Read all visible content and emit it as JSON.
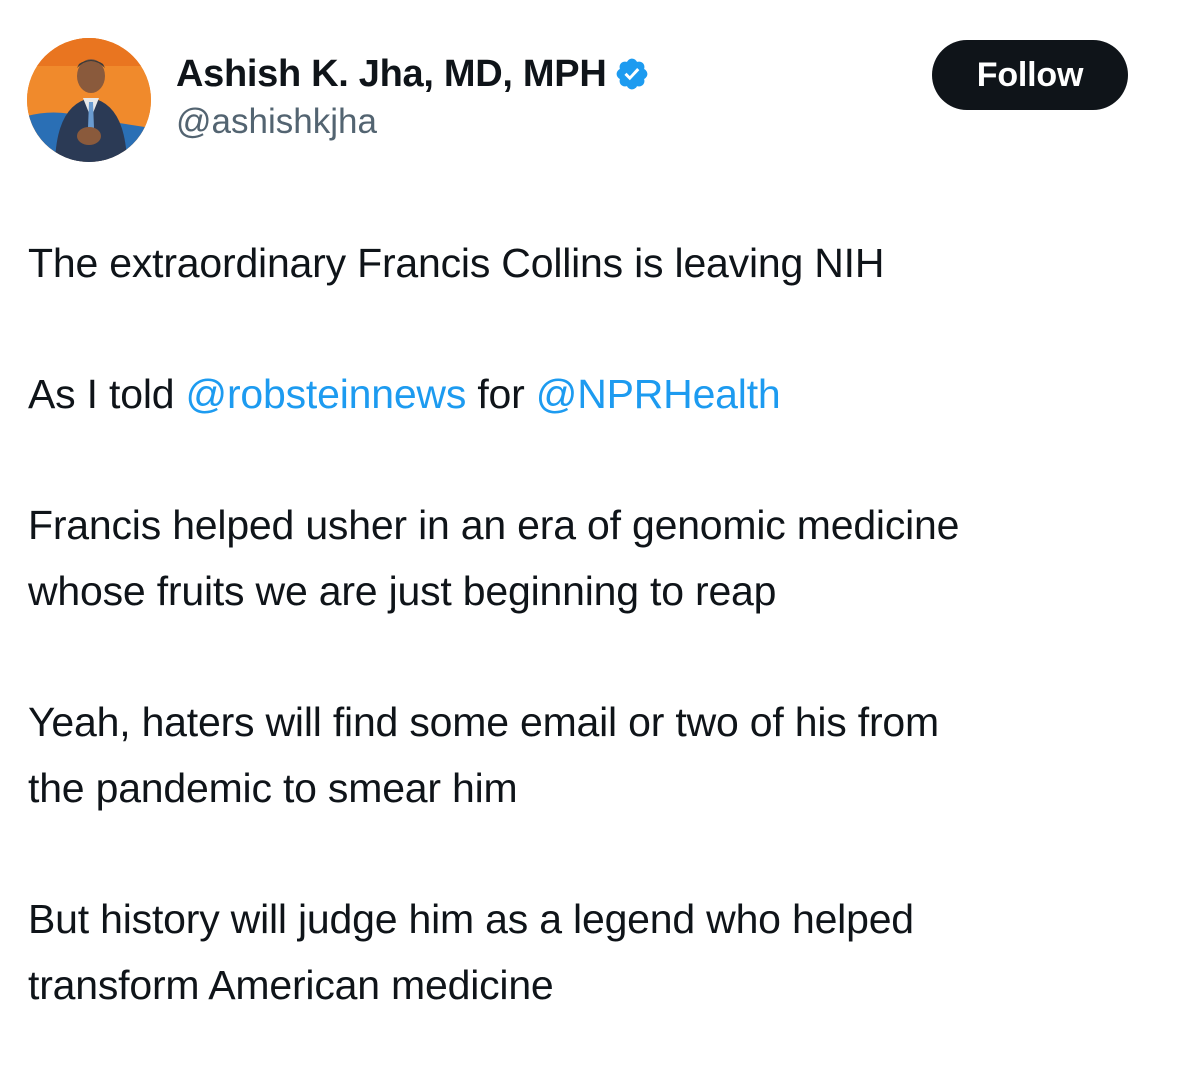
{
  "author": {
    "display_name": "Ashish K. Jha, MD, MPH",
    "handle": "@ashishkjha",
    "verified": true,
    "avatar_icon": "profile-photo-person-in-suit"
  },
  "follow_button": {
    "label": "Follow"
  },
  "tweet": {
    "p1": "The extraordinary Francis Collins is leaving NIH",
    "p2_prefix": "As I told ",
    "p2_mention1": "@robsteinnews",
    "p2_middle": " for ",
    "p2_mention2": "@NPRHealth",
    "p3_line1": "Francis helped usher in an era of genomic medicine",
    "p3_line2": "whose fruits we are just beginning to reap",
    "p4_line1": "Yeah, haters will find some email or two of his from",
    "p4_line2": "the pandemic to smear him",
    "p5_line1": "But history will judge him as a legend who helped",
    "p5_line2": "transform American medicine"
  },
  "colors": {
    "text": "#0f1419",
    "secondary": "#536471",
    "link": "#1d9bf0",
    "verified_badge": "#1d9bf0",
    "follow_bg": "#0f1419"
  }
}
